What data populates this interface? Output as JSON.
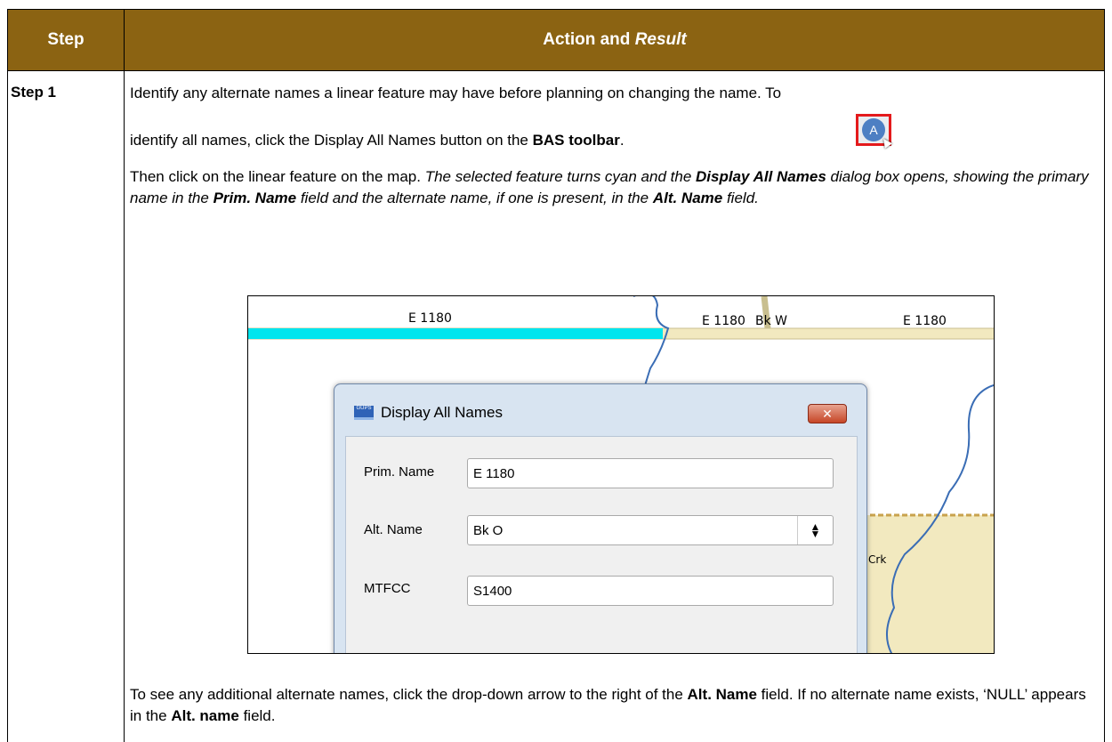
{
  "table": {
    "header_step": "Step",
    "header_action": "Action and",
    "header_result": "Result",
    "step_label": "Step 1"
  },
  "text": {
    "p1_line1": "Identify any alternate names a linear feature may have before planning on changing the name. To",
    "p1_line2_a": "identify all names, click the Display All Names button on the ",
    "p1_line2_bold": "BAS toolbar",
    "p1_line2_end": ".",
    "p2_a": "Then click on the linear feature on the map. ",
    "p2_b": "The selected feature turns cyan and the ",
    "p2_c": "Display All Names",
    "p2_d": " dialog box opens, showing the primary name in the ",
    "p2_e": "Prim. Name",
    "p2_f": " field and the alternate name, if one is present, in the ",
    "p2_g": "Alt. Name",
    "p2_h": " field.",
    "p3_a": "To see any additional alternate names, click the drop-down arrow to the right of the ",
    "p3_b": "Alt. Name",
    "p3_c": " field. If no alternate name exists, ‘NULL’ appears in the ",
    "p3_d": "Alt. name",
    "p3_e": " field."
  },
  "toolbar_button": {
    "letter": "A",
    "icon": "display-all-names-icon",
    "highlight_color": "#e41a1c"
  },
  "map": {
    "labels": [
      "E 1180",
      "E 1180",
      "Bk W",
      "E 1180",
      "Crk"
    ],
    "selected_color": "#00e5ee",
    "road_color": "#f2e9bf",
    "stream_color": "#3a6db5"
  },
  "dialog": {
    "logo": "GUPS",
    "title": "Display All Names",
    "close_glyph": "✕",
    "fields": [
      {
        "label": "Prim. Name",
        "value": "E 1180"
      },
      {
        "label": "Alt. Name",
        "value": "Bk O"
      },
      {
        "label": "MTFCC",
        "value": "S1400"
      }
    ]
  }
}
